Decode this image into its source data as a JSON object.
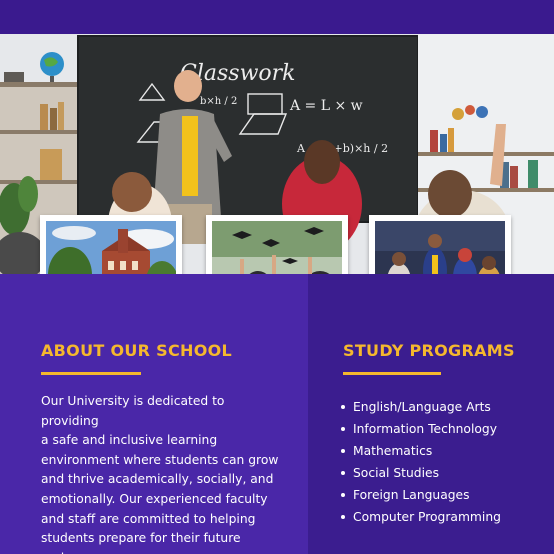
{
  "chalkboard": {
    "title": "Classwork",
    "formulas": [
      "A = L × w",
      "A = (B+b)×h / 2",
      "b×h / 2",
      "L",
      "w",
      "A",
      "B",
      "b"
    ]
  },
  "about": {
    "heading": "ABOUT OUR SCHOOL",
    "lines": [
      "Our University is dedicated to providing",
      "a safe and inclusive learning",
      "environment where students can grow",
      "and thrive academically, socially, and",
      "emotionally. Our experienced faculty",
      "and staff are committed to helping",
      "students prepare for their future",
      "endeavors"
    ]
  },
  "programs": {
    "heading": "STUDY PROGRAMS",
    "items": [
      "English/Language Arts",
      "Information Technology",
      "Mathematics",
      "Social Studies",
      "Foreign Languages",
      "Computer Programming"
    ]
  },
  "colors": {
    "accent": "#f5b82e",
    "panel_left": "#4a27a8",
    "panel_right": "#3b1d8f",
    "text": "#ffffff"
  },
  "images": [
    "classroom-photo",
    "campus-building-photo",
    "graduation-caps-photo",
    "students-group-photo"
  ]
}
